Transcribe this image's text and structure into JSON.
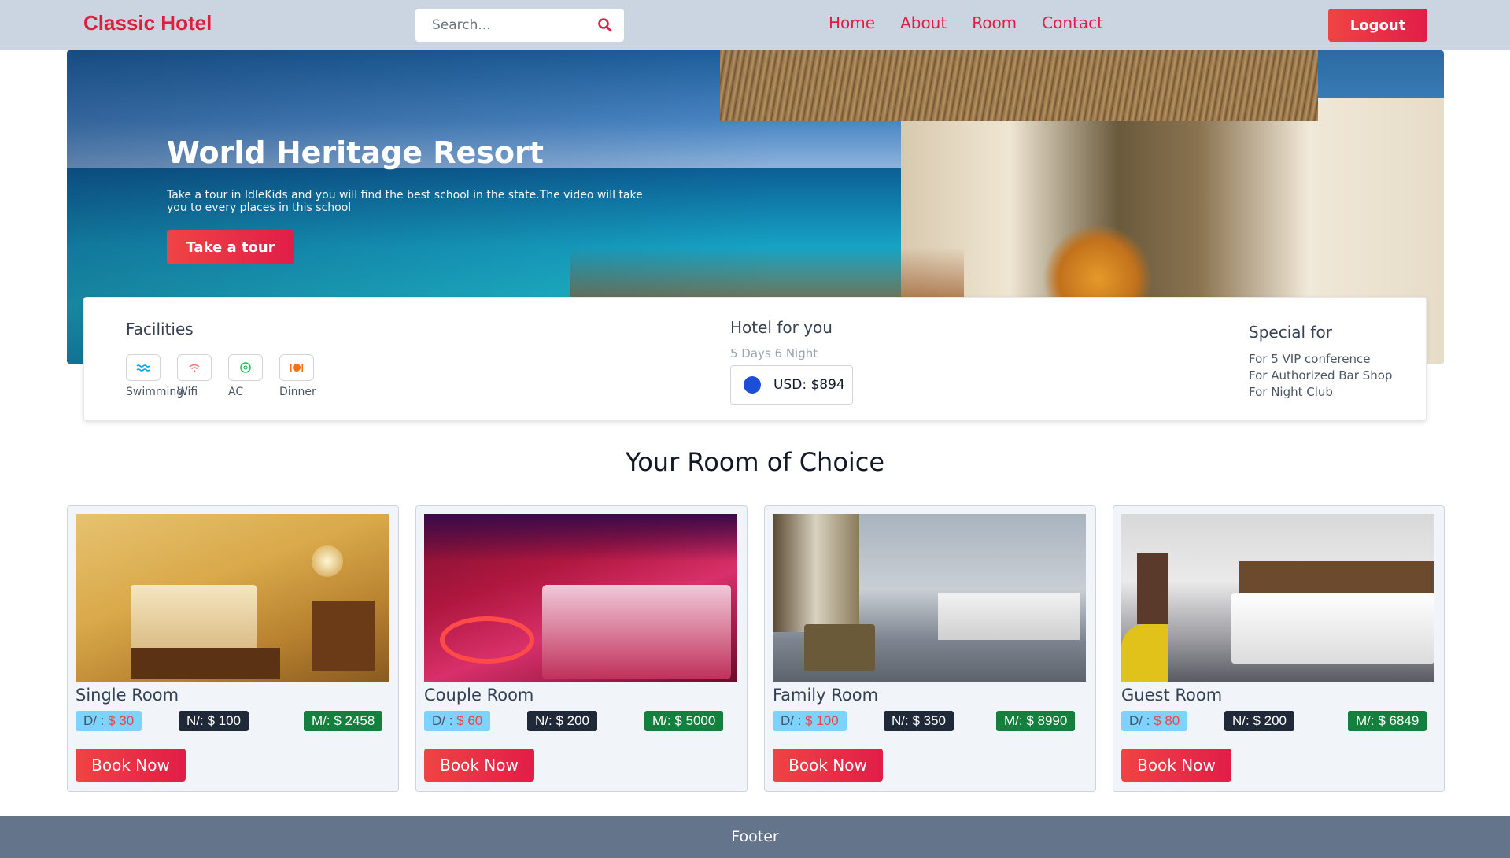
{
  "navbar": {
    "brand": "Classic Hotel",
    "search_placeholder": "Search...",
    "links": [
      "Home",
      "About",
      "Room",
      "Contact"
    ],
    "logout_label": "Logout"
  },
  "hero": {
    "title": "World Heritage Resort",
    "text": "Take a tour in IdleKids and you will find the best school in the state.The video will take you to every places in this school",
    "button_label": "Take a tour"
  },
  "facilities": {
    "title": "Facilities",
    "items": [
      {
        "label": "Swimming",
        "icon": "swimming-icon",
        "color": "#0ea5e9"
      },
      {
        "label": "Wifi",
        "icon": "wifi-icon",
        "color": "#f87171"
      },
      {
        "label": "AC",
        "icon": "ac-icon",
        "color": "#22c55e"
      },
      {
        "label": "Dinner",
        "icon": "dinner-icon",
        "color": "#f97316"
      }
    ]
  },
  "hotel_for_you": {
    "title": "Hotel for you",
    "subtitle": "5 Days 6 Night",
    "price": "USD: $894"
  },
  "special_for": {
    "title": "Special for",
    "items": [
      "For 5 VIP conference",
      "For Authorized Bar Shop",
      "For Night Club"
    ]
  },
  "rooms_section": {
    "title": "Your Room of Choice",
    "rooms": [
      {
        "name": "Single Room",
        "day_prefix": "D/ : ",
        "day_price": "$ 30",
        "night": "N/: $ 100",
        "month": "M/: $ 2458",
        "book_label": "Book Now"
      },
      {
        "name": "Couple Room",
        "day_prefix": "D/ : ",
        "day_price": "$ 60",
        "night": "N/: $ 200",
        "month": "M/: $ 5000",
        "book_label": "Book Now"
      },
      {
        "name": "Family Room",
        "day_prefix": "D/ : ",
        "day_price": "$ 100",
        "night": "N/: $ 350",
        "month": "M/: $ 8990",
        "book_label": "Book Now"
      },
      {
        "name": "Guest Room",
        "day_prefix": "D/ : ",
        "day_price": "$ 80",
        "night": "N/: $ 200",
        "month": "M/: $ 6849",
        "book_label": "Book Now"
      }
    ]
  },
  "footer": {
    "text": "Footer"
  },
  "colors": {
    "accent": "#e11d48",
    "navbar_bg": "#cbd5e1",
    "footer_bg": "#64748b"
  }
}
